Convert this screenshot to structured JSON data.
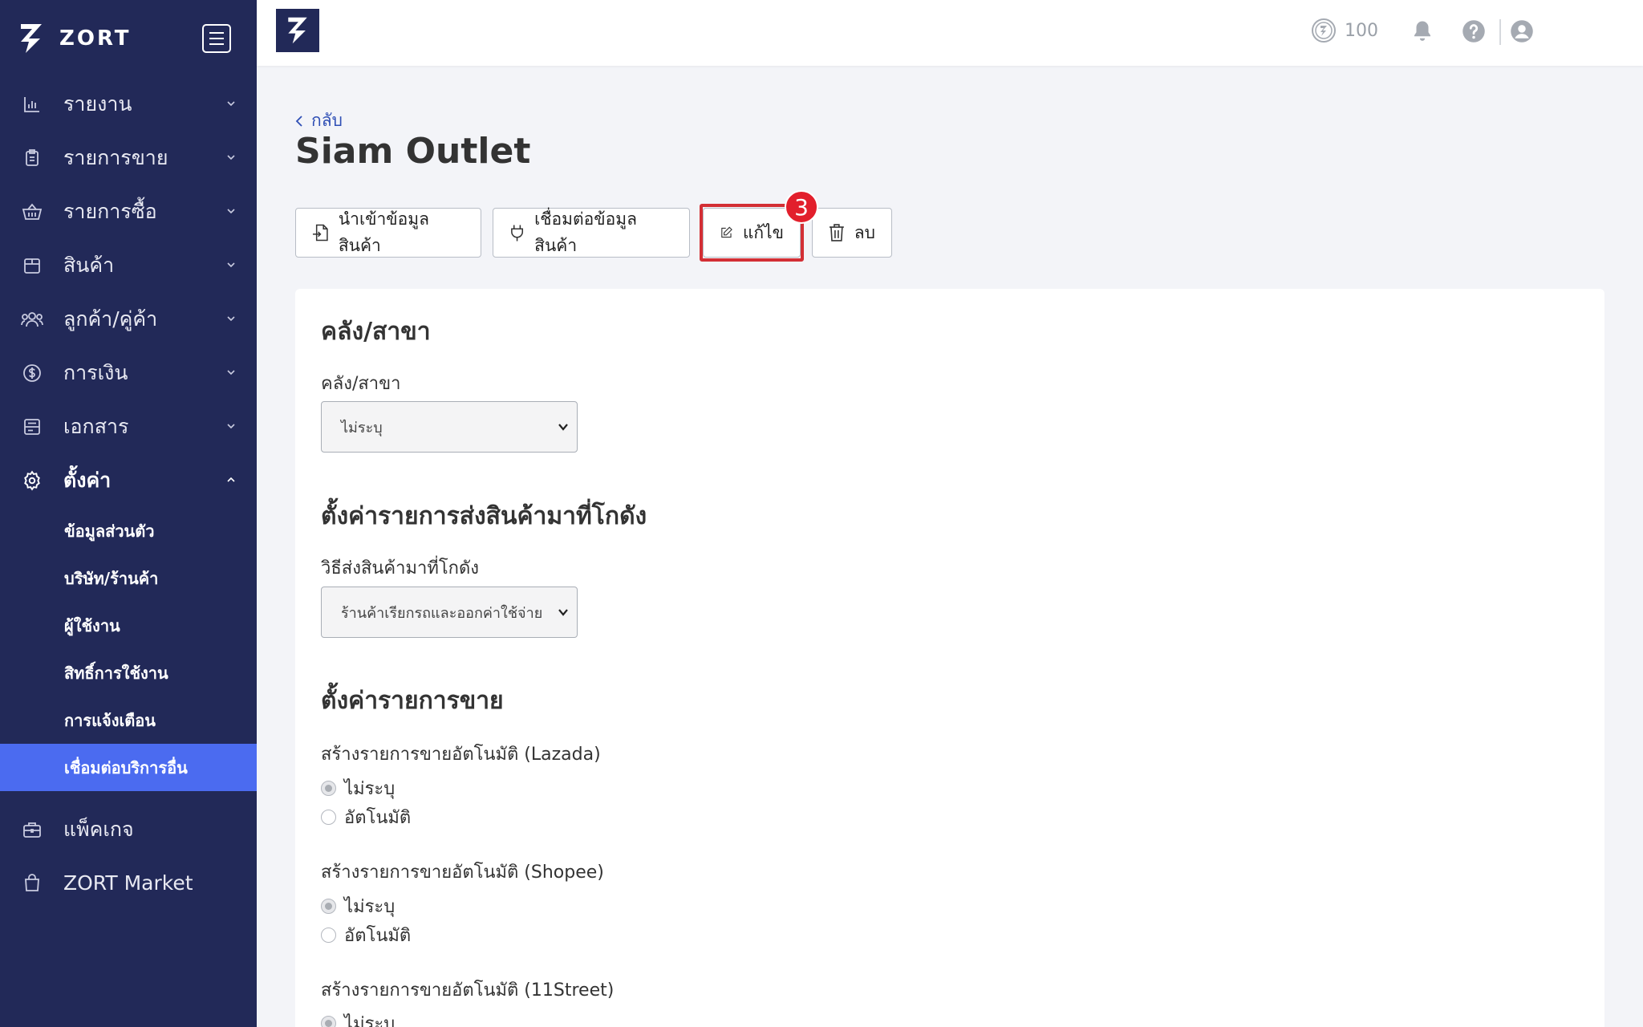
{
  "brand": {
    "name": "ZORT"
  },
  "sidebar": {
    "items": [
      {
        "label": "รายงาน",
        "icon": "chart-icon"
      },
      {
        "label": "รายการขาย",
        "icon": "clipboard-icon"
      },
      {
        "label": "รายการซื้อ",
        "icon": "basket-icon"
      },
      {
        "label": "สินค้า",
        "icon": "box-icon"
      },
      {
        "label": "ลูกค้า/คู่ค้า",
        "icon": "users-icon"
      },
      {
        "label": "การเงิน",
        "icon": "dollar-icon"
      },
      {
        "label": "เอกสาร",
        "icon": "document-icon"
      },
      {
        "label": "ตั้งค่า",
        "icon": "gear-icon"
      }
    ],
    "settings_sub": [
      "ข้อมูลส่วนตัว",
      "บริษัท/ร้านค้า",
      "ผู้ใช้งาน",
      "สิทธิ์การใช้งาน",
      "การแจ้งเตือน",
      "เชื่อมต่อบริการอื่น"
    ],
    "bottom_items": [
      {
        "label": "แพ็คเกจ",
        "icon": "briefcase-icon"
      },
      {
        "label": "ZORT Market",
        "icon": "shopping-bag-icon"
      }
    ]
  },
  "topbar": {
    "credits": "100"
  },
  "page": {
    "back_label": "กลับ",
    "title": "Siam Outlet",
    "actions": {
      "import": "นำเข้าข้อมูลสินค้า",
      "connect": "เชื่อมต่อข้อมูลสินค้า",
      "edit": "แก้ไข",
      "delete": "ลบ"
    },
    "step_badge": "3"
  },
  "form": {
    "warehouse_section": "คลัง/สาขา",
    "warehouse_label": "คลัง/สาขา",
    "warehouse_value": "ไม่ระบุ",
    "shipping_section": "ตั้งค่ารายการส่งสินค้ามาที่โกดัง",
    "shipping_label": "วิธีส่งสินค้ามาที่โกดัง",
    "shipping_value": "ร้านค้าเรียกรถและออกค่าใช้จ่าย",
    "sales_section": "ตั้งค่ารายการขาย",
    "auto_lazada_label": "สร้างรายการขายอัตโนมัติ (Lazada)",
    "auto_shopee_label": "สร้างรายการขายอัตโนมัติ (Shopee)",
    "auto_11street_label": "สร้างรายการขายอัตโนมัติ (11Street)",
    "opt_none": "ไม่ระบุ",
    "opt_auto": "อัตโนมัติ"
  }
}
